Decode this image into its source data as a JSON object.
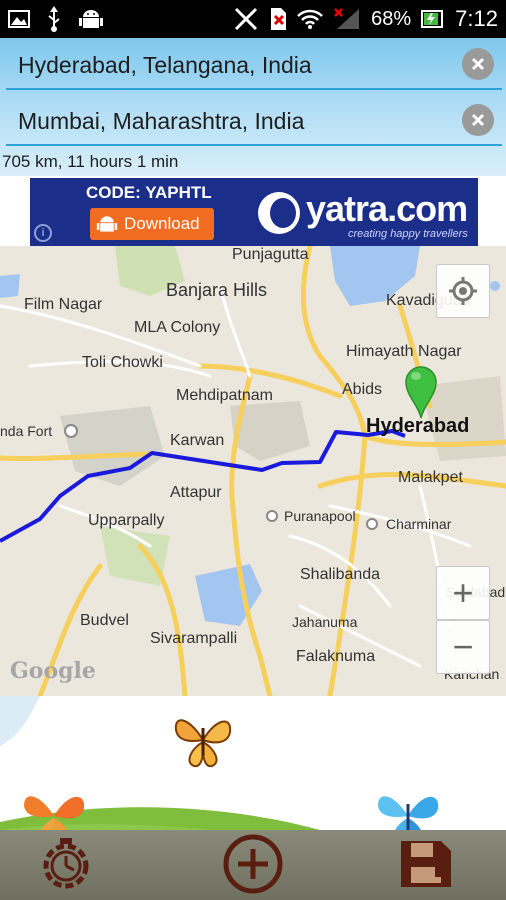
{
  "status_bar": {
    "battery_text": "68%",
    "time": "7:12",
    "left_icons": [
      "image-icon",
      "usb-icon",
      "android-icon"
    ],
    "right_icons": [
      "vibrate-icon",
      "sim-icon",
      "wifi-icon",
      "signal-icon",
      "battery-icon"
    ]
  },
  "route": {
    "origin": "Hyderabad, Telangana, India",
    "destination": "Mumbai, Maharashtra, India",
    "summary": "705 km, 11 hours 1 min"
  },
  "ad": {
    "code_text": "CODE: YAPHTL",
    "download_label": "Download",
    "brand": "yatra.com",
    "tagline": "creating happy travellers"
  },
  "map": {
    "labels": {
      "punjagutta": "Punjagutta",
      "film_nagar": "Film Nagar",
      "banjara_hills": "Banjara Hills",
      "kavadiguda": "Kavadiguda",
      "mla_colony": "MLA Colony",
      "himayath_nagar": "Himayath Nagar",
      "toli_chowki": "Toli Chowki",
      "abids": "Abids",
      "mehdipatnam": "Mehdipatnam",
      "hyderabad": "Hyderabad",
      "golconda_fort": "nda Fort",
      "karwan": "Karwan",
      "malakpet": "Malakpet",
      "attapur": "Attapur",
      "puranapool": "Puranapool",
      "upparpally": "Upparpally",
      "charminar": "Charminar",
      "shalibanda": "Shalibanda",
      "saidabad": "Saidabad",
      "budvel": "Budvel",
      "jahanuma": "Jahanuma",
      "sivarampalli": "Sivarampalli",
      "falaknuma": "Falaknuma",
      "kanchan": "Kanchan"
    },
    "watermark": "Google",
    "zoom_in": "+",
    "zoom_out": "−"
  },
  "toolbar": {
    "left_icon": "timer-gear-icon",
    "center_icon": "add-circle-icon",
    "right_icon": "save-disk-icon"
  },
  "colors": {
    "route_line": "#1a1adc",
    "marker": "#3fbf3f",
    "accent": "#2fa2d9",
    "ad_background": "#1b2e8a",
    "download_button": "#f26c21"
  }
}
